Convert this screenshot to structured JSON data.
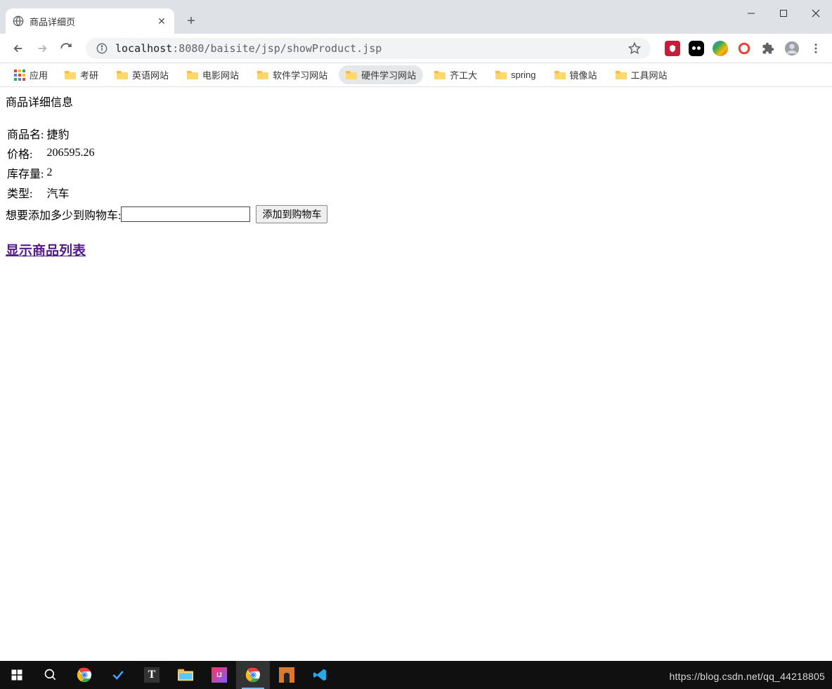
{
  "browser": {
    "tab_title": "商品详细页",
    "url_host": "localhost",
    "url_path": ":8080/baisite/jsp/showProduct.jsp"
  },
  "bookmarks": {
    "apps_label": "应用",
    "items": [
      {
        "label": "考研",
        "active": false
      },
      {
        "label": "英语网站",
        "active": false
      },
      {
        "label": "电影网站",
        "active": false
      },
      {
        "label": "软件学习网站",
        "active": false
      },
      {
        "label": "硬件学习网站",
        "active": true
      },
      {
        "label": "齐工大",
        "active": false
      },
      {
        "label": "spring",
        "active": false
      },
      {
        "label": "镜像站",
        "active": false
      },
      {
        "label": "工具网站",
        "active": false
      }
    ]
  },
  "page": {
    "heading": "商品详细信息",
    "fields": {
      "name_label": "商品名:",
      "name_value": "捷豹",
      "price_label": "价格:",
      "price_value": "206595.26",
      "stock_label": "库存量:",
      "stock_value": "2",
      "type_label": "类型:",
      "type_value": "汽车"
    },
    "cart_prompt": "想要添加多少到购物车:",
    "cart_input_value": "",
    "cart_button": "添加到购物车",
    "back_link": "显示商品列表"
  },
  "watermark": "https://blog.csdn.net/qq_44218805"
}
